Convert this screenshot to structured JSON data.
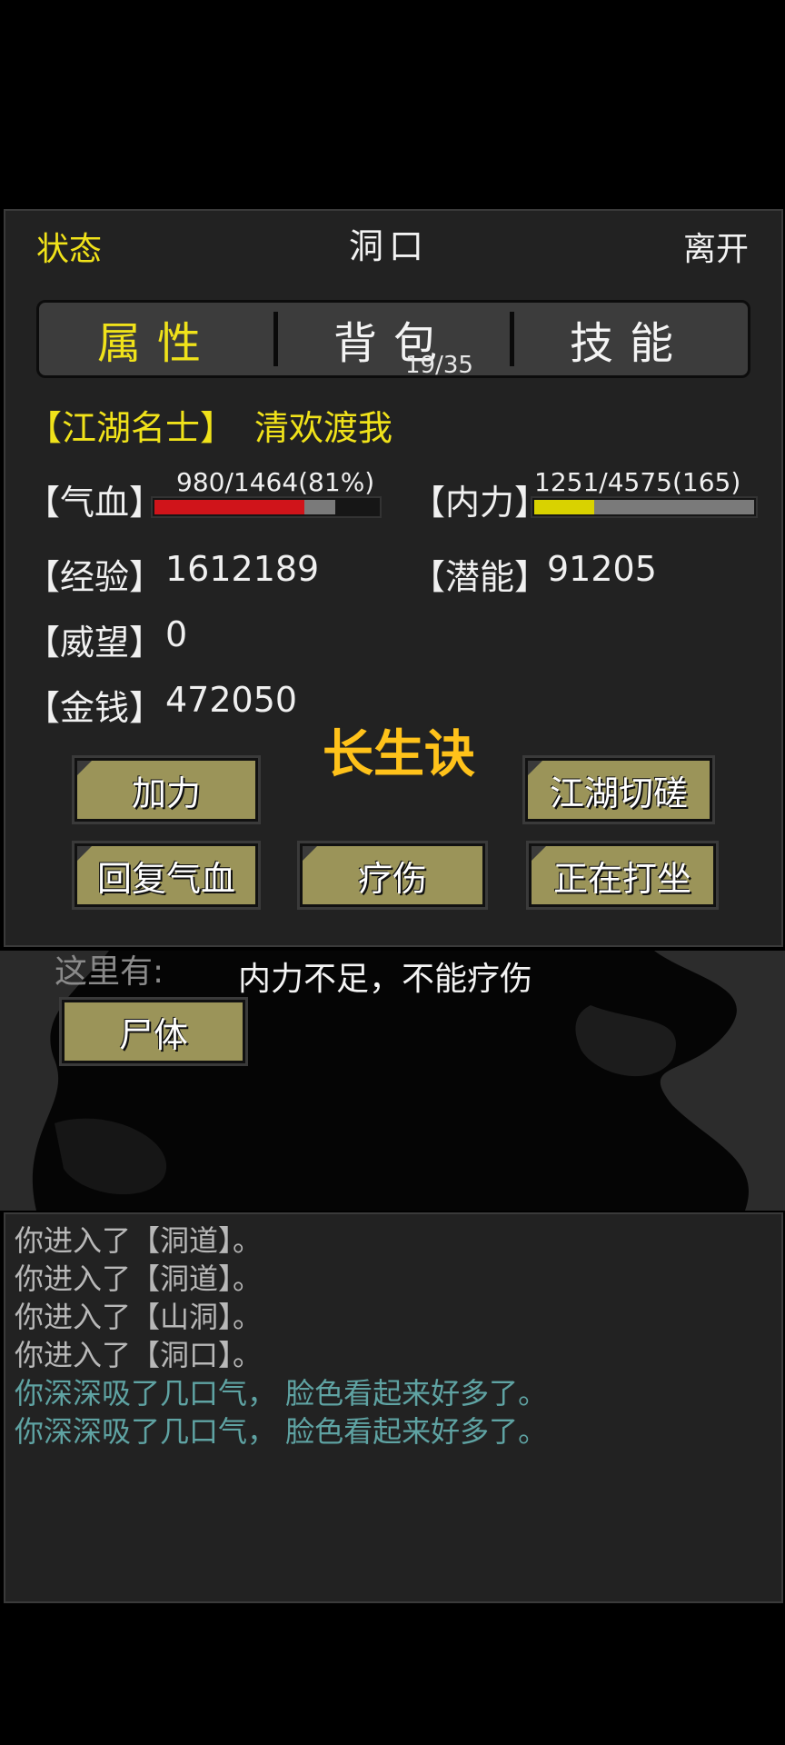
{
  "header": {
    "status": "状态",
    "location": "洞口",
    "leave": "离开"
  },
  "tabs": [
    {
      "label": "属性",
      "active": true
    },
    {
      "label": "背包",
      "count": "19/35"
    },
    {
      "label": "技能"
    }
  ],
  "character": {
    "title": "【江湖名士】",
    "name": "清欢渡我"
  },
  "stats": {
    "hp": {
      "label": "【气血】",
      "value": "980/1464(81%)",
      "fraction": 0.81,
      "current_fraction": 0.67,
      "color": "#d0141a"
    },
    "mana": {
      "label": "【内力】",
      "value": "1251/4575(165)",
      "fraction": 1.0,
      "current_fraction": 0.273,
      "color": "#d9d200"
    },
    "exp": {
      "label": "【经验】",
      "value": "1612189"
    },
    "potential": {
      "label": "【潜能】",
      "value": "91205"
    },
    "prestige": {
      "label": "【威望】",
      "value": "0"
    },
    "money": {
      "label": "【金钱】",
      "value": "472050"
    }
  },
  "overlay_title": "长生诀",
  "buttons": {
    "boost": "加力",
    "spar": "江湖切磋",
    "heal_hp": "回复气血",
    "treat": "疗伤",
    "meditate": "正在打坐"
  },
  "scene": {
    "here_label": "这里有:",
    "hint": "内力不足，不能疗伤",
    "objects": [
      "尸体"
    ]
  },
  "log": [
    {
      "text": "你进入了【洞道】。",
      "color": "#b8b8b8"
    },
    {
      "text": "你进入了【洞道】。",
      "color": "#b8b8b8"
    },
    {
      "text": "你进入了【山洞】。",
      "color": "#b8b8b8"
    },
    {
      "text": "你进入了【洞口】。",
      "color": "#b8b8b8"
    },
    {
      "text": "你深深吸了几口气， 脸色看起来好多了。",
      "color": "#5fa3a3"
    },
    {
      "text": "你深深吸了几口气， 脸色看起来好多了。",
      "color": "#5fa3a3"
    }
  ]
}
